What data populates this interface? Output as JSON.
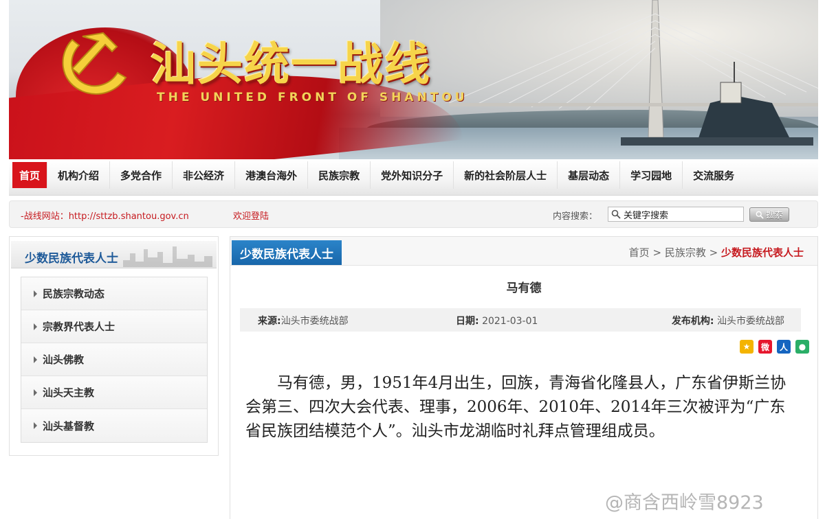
{
  "banner": {
    "title": "汕头统一战线",
    "subtitle": "THE UNITED FRONT OF SHANTOU"
  },
  "nav": {
    "items": [
      {
        "label": "首页",
        "active": true
      },
      {
        "label": "机构介绍"
      },
      {
        "label": "多党合作"
      },
      {
        "label": "非公经济"
      },
      {
        "label": "港澳台海外"
      },
      {
        "label": "民族宗教"
      },
      {
        "label": "党外知识分子"
      },
      {
        "label": "新的社会阶层人士"
      },
      {
        "label": "基层动态"
      },
      {
        "label": "学习园地"
      },
      {
        "label": "交流服务"
      }
    ]
  },
  "bar": {
    "site_link": "-战线网站：http://sttzb.shantou.gov.cn",
    "welcome": "欢迎登陆",
    "search_label": "内容搜索：",
    "search_value": "关键字搜索",
    "search_button": "搜索"
  },
  "sidebar": {
    "title": "少数民族代表人士",
    "items": [
      {
        "label": "民族宗教动态"
      },
      {
        "label": "宗教界代表人士"
      },
      {
        "label": "汕头佛教"
      },
      {
        "label": "汕头天主教"
      },
      {
        "label": "汕头基督教"
      }
    ]
  },
  "main": {
    "tab": "少数民族代表人士",
    "breadcrumb": {
      "home": "首页",
      "sep1": ">",
      "section": "民族宗教",
      "sep2": ">",
      "current": "少数民族代表人士"
    },
    "article": {
      "title": "马有德",
      "source_label": "来源:",
      "source": "汕头市委统战部",
      "date_label": "日期:",
      "date": "2021-03-01",
      "org_label": "发布机构:",
      "org": "汕头市委统战部",
      "body": "马有德，男，1951年4月出生，回族，青海省化隆县人，广东省伊斯兰协会第三、四次大会代表、理事，2006年、2010年、2014年三次被评为“广东省民族团结模范个人”。汕头市龙湖临时礼拜点管理组成员。"
    },
    "share_icons": [
      "qzone-icon",
      "weibo-icon",
      "renren-icon",
      "wechat-icon"
    ]
  },
  "watermark": "@商含西岭雪8923",
  "colors": {
    "accent_red": "#d8141b",
    "link_red": "#c61a1f",
    "heading_blue": "#1e5a99",
    "tab_blue": "#1866aa"
  }
}
